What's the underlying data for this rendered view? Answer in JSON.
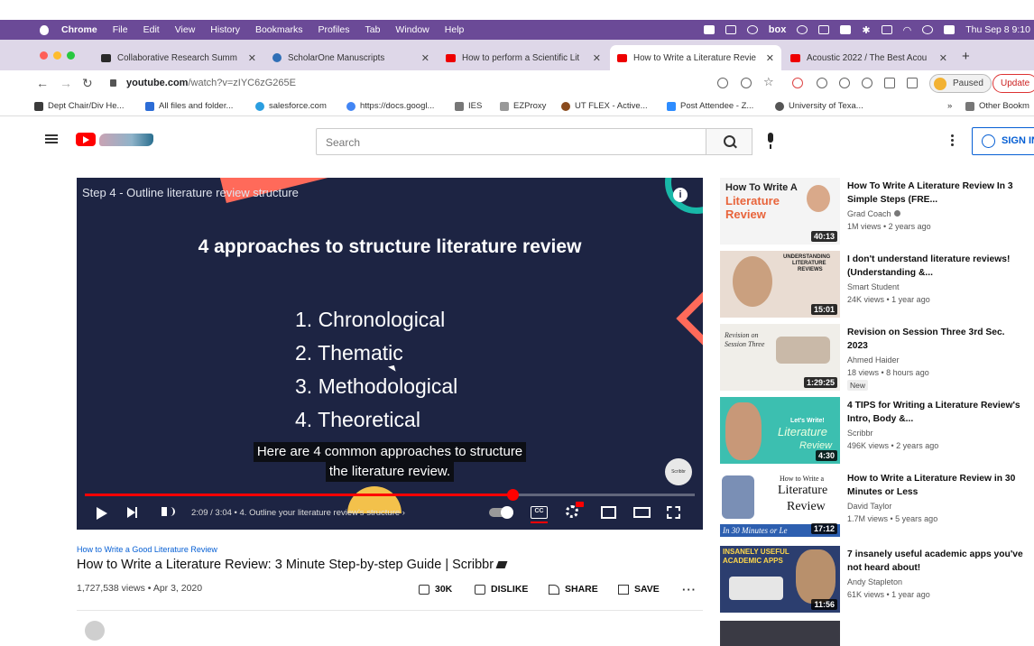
{
  "menubar": {
    "app": "Chrome",
    "items": [
      "File",
      "Edit",
      "View",
      "History",
      "Bookmarks",
      "Profiles",
      "Tab",
      "Window",
      "Help"
    ],
    "status_icons": [
      "box-icon",
      "wifi-icon",
      "bluetooth-icon",
      "search-icon"
    ],
    "box_label": "box",
    "clock": "Thu Sep 8 9:10"
  },
  "tabs": [
    {
      "title": "Collaborative Research Summ",
      "favicon": "doc"
    },
    {
      "title": "ScholarOne Manuscripts",
      "favicon": "so"
    },
    {
      "title": "How to perform a Scientific Lit",
      "favicon": "yt"
    },
    {
      "title": "How to Write a Literature Revie",
      "favicon": "yt",
      "active": true
    },
    {
      "title": "Acoustic 2022 / The Best Acou",
      "favicon": "yt"
    }
  ],
  "address": {
    "domain": "youtube.com",
    "path": "/watch?v=zIYC6zG265E",
    "paused_label": "Paused",
    "update_label": "Update"
  },
  "bookmarks": [
    {
      "label": "Dept Chair/Div He...",
      "color": "#3b3b3b"
    },
    {
      "label": "All files and folder...",
      "color": "#2c6cd6"
    },
    {
      "label": "salesforce.com",
      "color": "#2a9ee0"
    },
    {
      "label": "https://docs.googl...",
      "color": "#4285f4"
    },
    {
      "label": "IES",
      "color": "#777777"
    },
    {
      "label": "EZProxy",
      "color": "#999999"
    },
    {
      "label": "UT FLEX - Active...",
      "color": "#8a4b1d"
    },
    {
      "label": "Post Attendee - Z...",
      "color": "#2d8cff"
    },
    {
      "label": "University of Texa...",
      "color": "#555555"
    },
    {
      "label": "Other Bookm",
      "color": "#777777"
    }
  ],
  "youtube": {
    "search_placeholder": "Search",
    "signin_label": "SIGN IN"
  },
  "player": {
    "step_label": "Step 4 - Outline literature review structure",
    "heading": "4 approaches to structure literature review",
    "list": [
      "1. Chronological",
      "2. Thematic",
      "3. Methodological",
      "4. Theoretical"
    ],
    "caption_line1": "Here are 4 common approaches to structure",
    "caption_line2": "the literature review.",
    "time": "2:09 / 3:04",
    "chapter": "4. Outline your literature review's structure",
    "progress": 0.7011,
    "brand_mark": "Scribbr"
  },
  "video": {
    "playlist": "How to Write a Good Literature Review",
    "title": "How to Write a Literature Review: 3 Minute Step-by-step Guide | Scribbr",
    "meta": "1,727,538 views • Apr 3, 2020",
    "likes": "30K",
    "dislike": "DISLIKE",
    "share": "SHARE",
    "save": "SAVE"
  },
  "recommendations": [
    {
      "title": "How To Write A Literature Review In 3 Simple Steps (FRE...",
      "channel": "Grad Coach",
      "verified": true,
      "views": "1M views • 2 years ago",
      "duration": "40:13",
      "thumb_lines": [
        "How To Write A",
        "Literature",
        "Review"
      ]
    },
    {
      "title": "I don't understand literature reviews! (Understanding &...",
      "channel": "Smart Student",
      "views": "24K views • 1 year ago",
      "duration": "15:01",
      "thumb_lines": [
        "UNDERSTANDING",
        "LITERATURE",
        "REVIEWS"
      ]
    },
    {
      "title": "Revision on Session Three 3rd Sec. 2023",
      "channel": "Ahmed Haider",
      "views": "18 views • 8 hours ago",
      "duration": "1:29:25",
      "badge": "New",
      "thumb_lines": [
        "Revision on",
        "Session Three"
      ]
    },
    {
      "title": "4 TIPS for Writing a Literature Review's Intro, Body &...",
      "channel": "Scribbr",
      "views": "496K views • 2 years ago",
      "duration": "4:30",
      "thumb_lines": [
        "Let's Write!",
        "Literature",
        "Review"
      ]
    },
    {
      "title": "How to Write a Literature Review in 30 Minutes or Less",
      "channel": "David Taylor",
      "views": "1.7M views • 5 years ago",
      "duration": "17:12",
      "thumb_lines": [
        "How to Write a",
        "Literature",
        "Review",
        "In 30 Minutes or Le"
      ]
    },
    {
      "title": "7 insanely useful academic apps you've not heard about!",
      "channel": "Andy Stapleton",
      "views": "61K views • 1 year ago",
      "duration": "11:56",
      "thumb_lines": [
        "INSANELY USEFUL",
        "ACADEMIC APPS"
      ]
    }
  ]
}
